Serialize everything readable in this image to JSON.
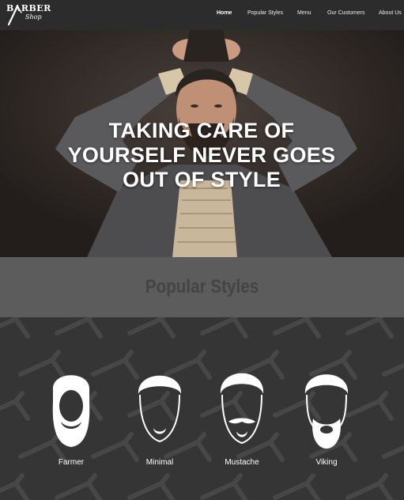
{
  "brand": {
    "logo_word": "BARBER",
    "logo_sub": "Shop"
  },
  "nav": {
    "items": [
      {
        "label": "Home",
        "active": true
      },
      {
        "label": "Popular Styles",
        "active": false
      },
      {
        "label": "Menu",
        "active": false
      },
      {
        "label": "Our Customers",
        "active": false
      },
      {
        "label": "About Us",
        "active": false
      }
    ]
  },
  "hero": {
    "title_lines": [
      "TAKING CARE OF",
      "YOURSELF NEVER GOES",
      "OUT OF STYLE"
    ]
  },
  "popular": {
    "title": "Popular Styles",
    "styles": [
      {
        "label": "Farmer",
        "icon": "beard-farmer-icon"
      },
      {
        "label": "Minimal",
        "icon": "beard-minimal-icon"
      },
      {
        "label": "Mustache",
        "icon": "beard-mustache-icon"
      },
      {
        "label": "Viking",
        "icon": "beard-viking-icon"
      }
    ]
  },
  "colors": {
    "nav_bg": "#2c2c2c",
    "section_head_bg": "#5c5c5c",
    "section_title": "#444444",
    "pattern_bg": "#353535",
    "pattern_icon": "#474747"
  }
}
